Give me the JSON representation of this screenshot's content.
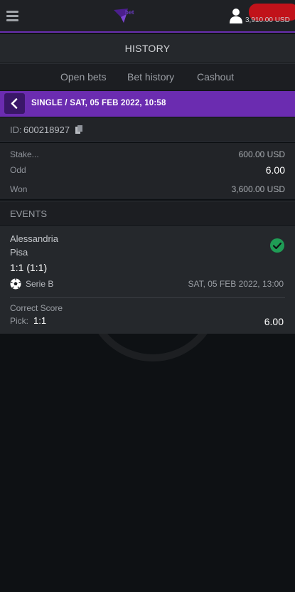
{
  "header": {
    "logo_text": "bet",
    "balance": "3,910.00 USD",
    "brand_color": "#6a2fb0"
  },
  "page": {
    "title": "HISTORY"
  },
  "tabs": [
    {
      "label": "Open bets"
    },
    {
      "label": "Bet history"
    },
    {
      "label": "Cashout"
    }
  ],
  "bet": {
    "title": "SINGLE / SAT, 05 FEB 2022, 10:58",
    "id_label": "ID:",
    "id_value": "600218927",
    "stake_label": "Stake...",
    "stake_value": "600.00 USD",
    "odd_label": "Odd",
    "odd_value": "6.00",
    "won_label": "Won",
    "won_value": "3,600.00 USD"
  },
  "events": {
    "header": "EVENTS",
    "items": [
      {
        "home": "Alessandria",
        "away": "Pisa",
        "score": "1:1 (1:1)",
        "status_icon": "check-circle-icon",
        "sport_icon": "soccer-ball-icon",
        "league": "Serie  B",
        "date": "SAT,  05  FEB  2022,  13:00",
        "market": "Correct Score",
        "pick_label": "Pick:",
        "pick_value": "1:1",
        "pick_odd": "6.00"
      }
    ]
  },
  "colors": {
    "accent": "#6b2cb0",
    "success": "#1f9c55",
    "balance_redaction": "#c1121a"
  }
}
